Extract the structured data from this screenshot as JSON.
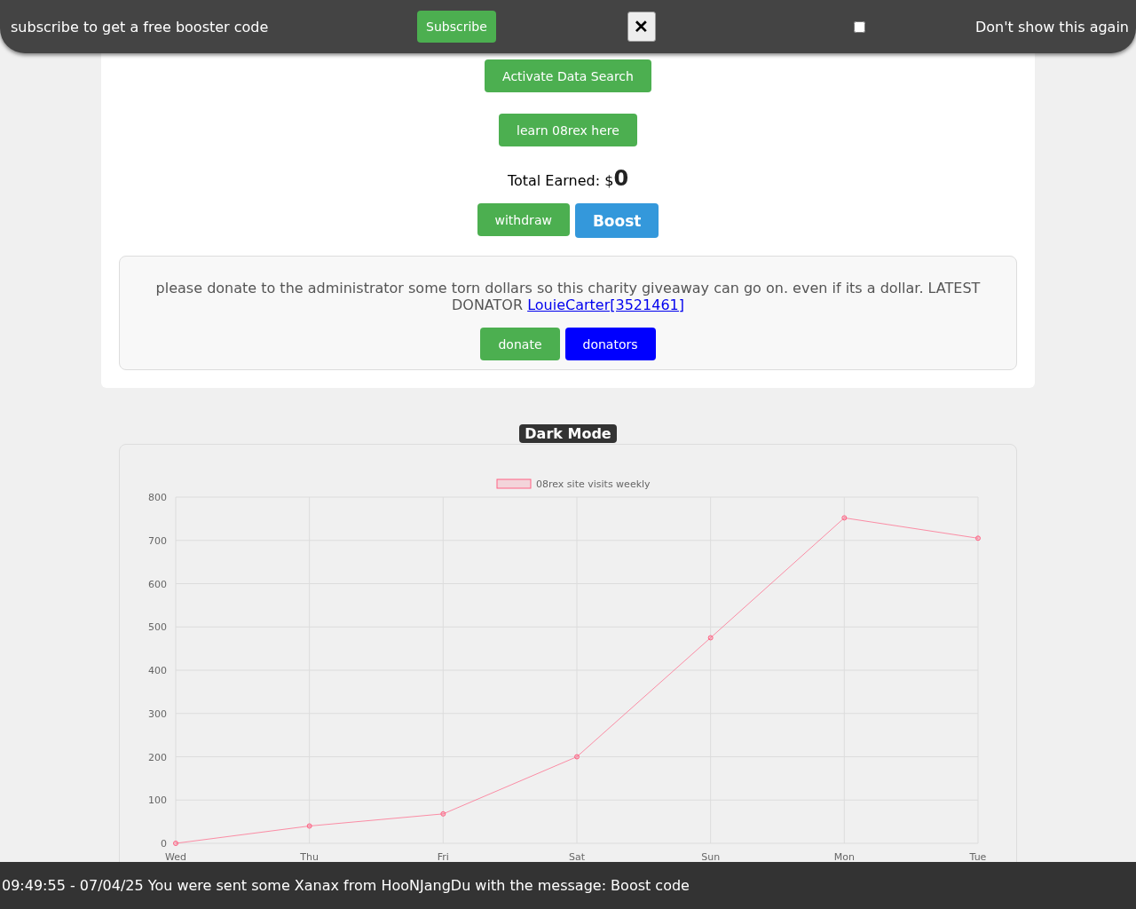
{
  "subscribe_bar": {
    "message": "subscribe to get a free booster code",
    "subscribe_button": "Subscribe",
    "close_button": "✕",
    "dont_show_checkbox": {
      "checked": false
    },
    "dont_show_label": "Don't show this again"
  },
  "card": {
    "activate_button": "Activate Data Search",
    "learn_button": "learn 08rex here",
    "total_label": "Total Earned: $",
    "total_value": "0",
    "withdraw_button": "withdraw",
    "boost_button": "Boost",
    "donate_box": {
      "message": "please donate to the administrator some torn dollars so this charity giveaway can go on. even if its a dollar. LATEST DONATOR",
      "donator_link": "LouieCarter[3521461]",
      "donate_button": "donate",
      "donators_button": "donators"
    }
  },
  "dark_mode_label": "Dark Mode",
  "chart": {
    "chart_data": {
      "type": "line",
      "categories": [
        "Wed",
        "Thu",
        "Fri",
        "Sat",
        "Sun",
        "Mon",
        "Tue"
      ],
      "series": [
        {
          "name": "08rex site visits weekly",
          "color": "#ff6384",
          "marker": true,
          "values": [
            0,
            40,
            68,
            200,
            475,
            752,
            705
          ]
        }
      ],
      "grid": true,
      "ylim": [
        0,
        800
      ],
      "yticks": [
        0,
        100,
        200,
        300,
        400,
        500,
        600,
        700,
        800
      ]
    }
  },
  "notification_bar": {
    "text": "09:49:55 - 07/04/25 You were sent some Xanax from HooNJangDu with the message: Boost code"
  }
}
